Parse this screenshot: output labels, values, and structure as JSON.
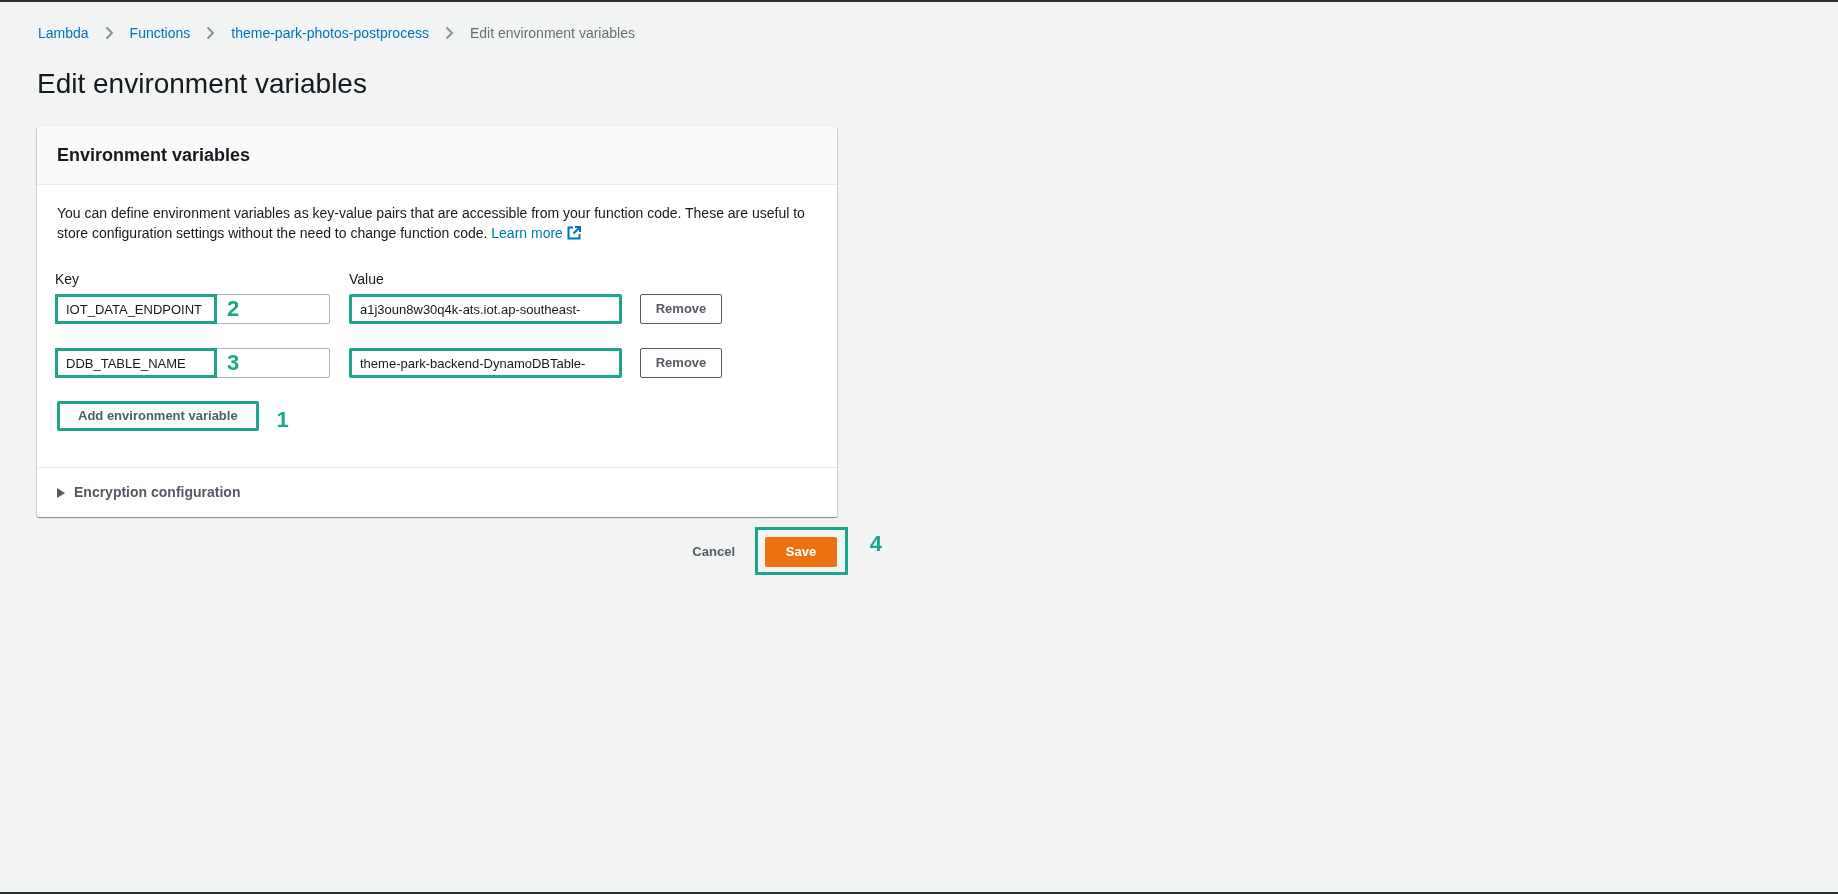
{
  "breadcrumbs": [
    {
      "label": "Lambda",
      "kind": "link"
    },
    {
      "label": "Functions",
      "kind": "link"
    },
    {
      "label": "theme-park-photos-postprocess",
      "kind": "link"
    },
    {
      "label": "Edit environment variables",
      "kind": "current"
    }
  ],
  "page_title": "Edit environment variables",
  "panel": {
    "title": "Environment variables",
    "description": "You can define environment variables as key-value pairs that are accessible from your function code. These are useful to store configuration settings without the need to change function code.",
    "learn_more": "Learn more",
    "key_label": "Key",
    "value_label": "Value",
    "variables": [
      {
        "key": "IOT_DATA_ENDPOINT",
        "key_highlighted": true,
        "key_callout": "2",
        "value": "a1j3oun8w30q4k-ats.iot.ap-southeast-",
        "value_highlighted": true,
        "remove": "Remove"
      },
      {
        "key": "DDB_TABLE_NAME",
        "key_highlighted": true,
        "key_callout": "3",
        "value": "theme-park-backend-DynamoDBTable-",
        "value_highlighted": true,
        "remove": "Remove"
      }
    ],
    "add_button": {
      "label": "Add environment variable",
      "highlighted": true,
      "callout": "1"
    },
    "encryption": {
      "label": "Encryption configuration",
      "expanded": false
    }
  },
  "footer": {
    "cancel": "Cancel",
    "save": {
      "label": "Save",
      "highlighted": true,
      "callout": "4"
    }
  }
}
